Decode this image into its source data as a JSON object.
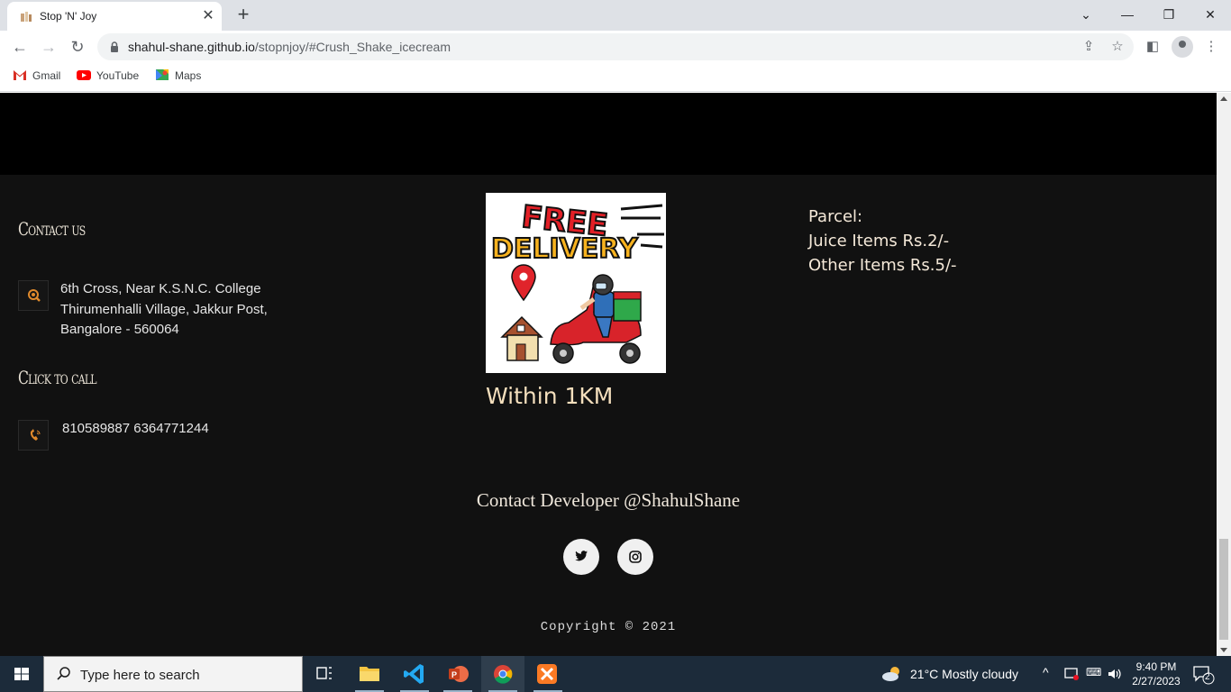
{
  "browser": {
    "tab_title": "Stop 'N' Joy",
    "url_host": "shahul-shane.github.io",
    "url_path": "/stopnjoy/#Crush_Shake_icecream",
    "bookmarks": [
      {
        "label": "Gmail",
        "icon": "gmail-icon"
      },
      {
        "label": "YouTube",
        "icon": "youtube-icon"
      },
      {
        "label": "Maps",
        "icon": "maps-icon"
      }
    ]
  },
  "footer": {
    "contact_heading": "Contact us",
    "address_lines": [
      "6th Cross, Near K.S.N.C. College",
      "Thirumenhalli Village, Jakkur Post,",
      "Bangalore - 560064"
    ],
    "call_heading": "Click to call",
    "phones": "810589887 6364771244",
    "delivery_image": {
      "line1": "FREE",
      "line2": "DELIVERY"
    },
    "within": "Within 1KM",
    "parcel_lines": [
      "Parcel:",
      "Juice Items Rs.2/-",
      "Other Items Rs.5/-"
    ],
    "developer": "Contact Developer @ShahulShane",
    "copyright": "Copyright © 2021"
  },
  "taskbar": {
    "search_placeholder": "Type here to search",
    "weather": "21°C  Mostly cloudy",
    "time": "9:40 PM",
    "date": "2/27/2023",
    "notifications": "2"
  },
  "colors": {
    "page_bg": "#111111",
    "band": "#000000",
    "accent": "#e08a2c",
    "heading": "#e9e2d5",
    "within": "#f4dfbd"
  }
}
